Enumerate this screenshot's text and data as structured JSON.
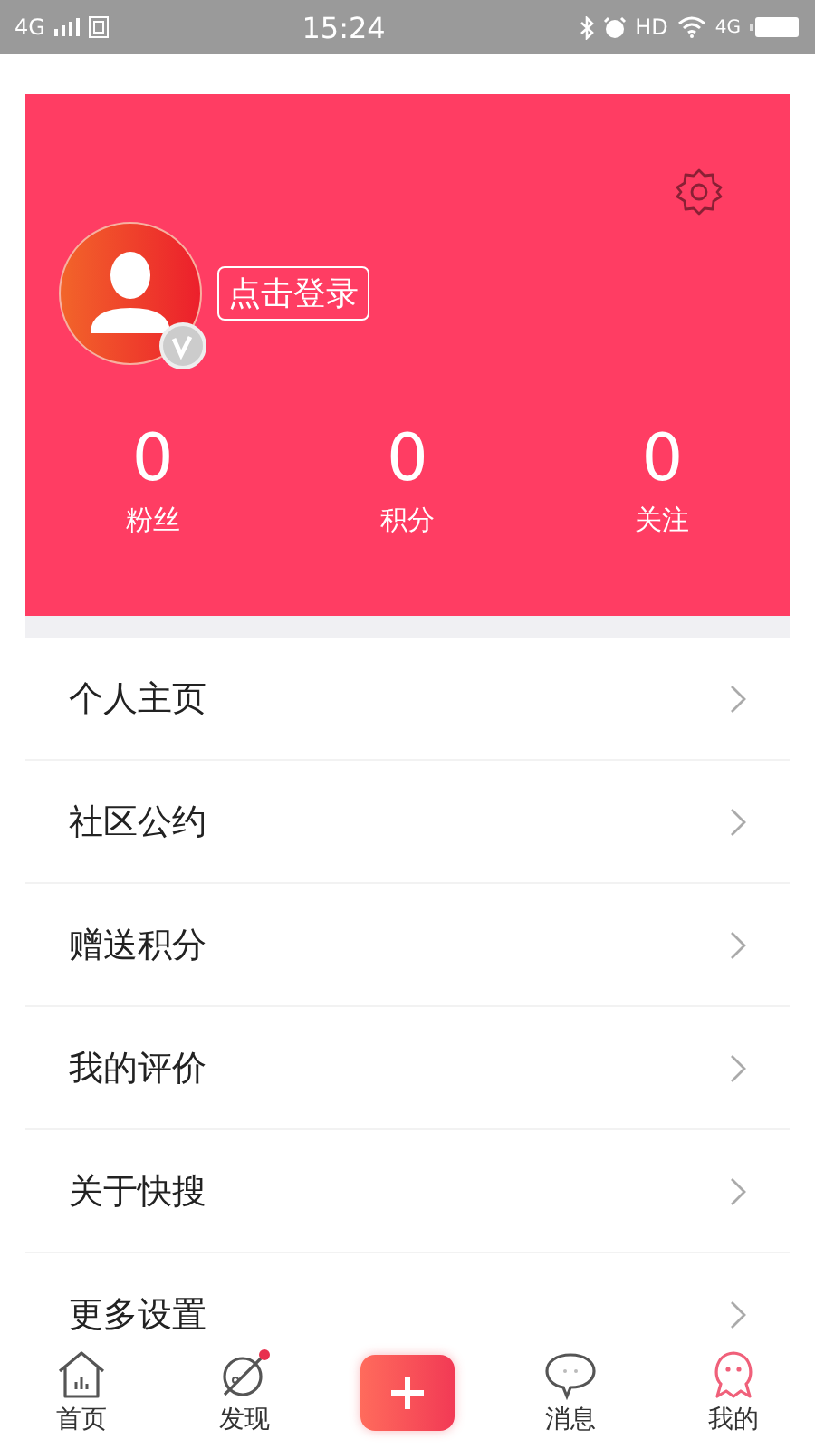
{
  "status_bar": {
    "network_left": "4G",
    "time": "15:24",
    "hd": "HD",
    "network_right": "4G"
  },
  "profile": {
    "login_button": "点击登录",
    "stats": [
      {
        "value": "0",
        "label": "粉丝"
      },
      {
        "value": "0",
        "label": "积分"
      },
      {
        "value": "0",
        "label": "关注"
      }
    ]
  },
  "menu": [
    {
      "label": "个人主页"
    },
    {
      "label": "社区公约"
    },
    {
      "label": "赠送积分"
    },
    {
      "label": "我的评价"
    },
    {
      "label": "关于快搜"
    },
    {
      "label": "更多设置"
    }
  ],
  "tabs": [
    {
      "kind": "home",
      "label": "首页",
      "selected": false,
      "badge": false
    },
    {
      "kind": "discover",
      "label": "发现",
      "selected": false,
      "badge": true
    },
    {
      "kind": "add",
      "selected": false,
      "badge": false
    },
    {
      "kind": "message",
      "label": "消息",
      "selected": false,
      "badge": false
    },
    {
      "kind": "me",
      "label": "我的",
      "selected": true,
      "badge": false
    }
  ]
}
